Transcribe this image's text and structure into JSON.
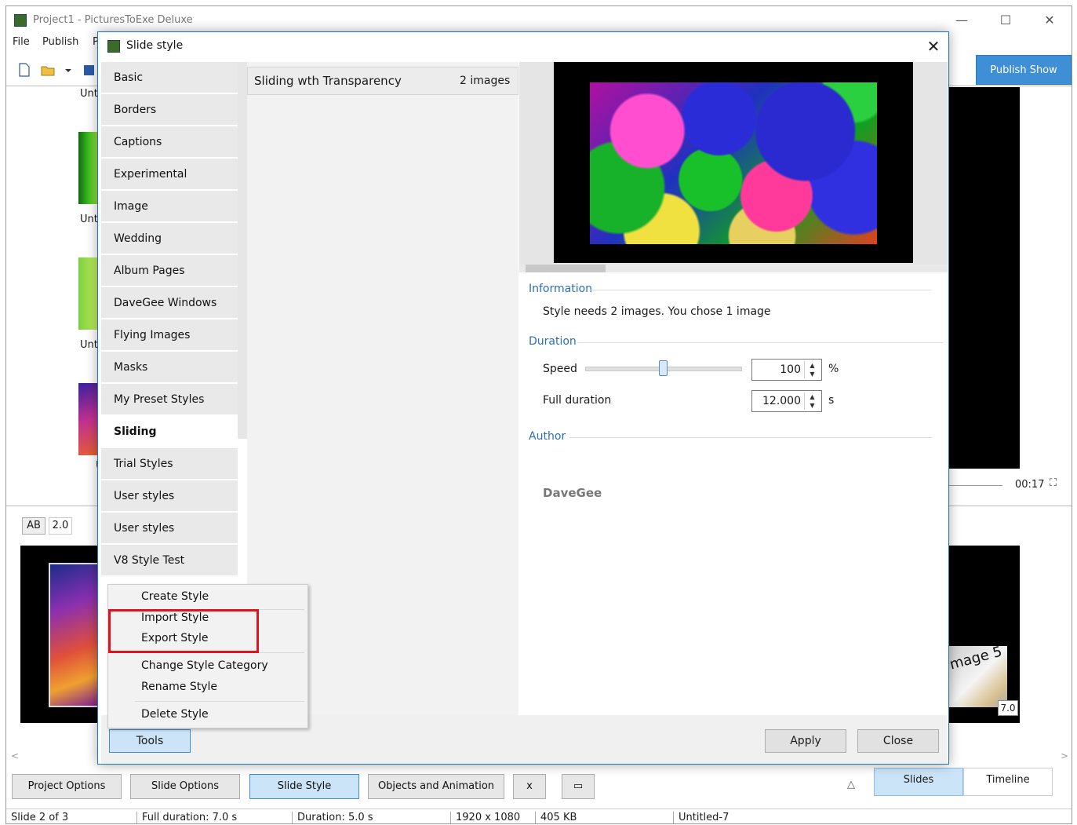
{
  "main_window": {
    "title": "Project1 - PicturesToExe Deluxe",
    "menu": [
      "File",
      "Publish",
      "P"
    ],
    "publish_button": "Publish Show",
    "minimize_glyph": "—",
    "maximize_glyph": "☐",
    "close_glyph": "✕"
  },
  "slide_list": {
    "labels": [
      "Unt",
      "Unt",
      "Unt",
      "U"
    ]
  },
  "preview": {
    "time": "00:17",
    "fullscreen_glyph": "⛶"
  },
  "timeline": {
    "ab_label": "AB",
    "ab_value": "2.0",
    "right_caption": "mage 5",
    "right_duration": "7.0"
  },
  "bottom_bar": {
    "buttons": [
      "Project Options",
      "Slide Options",
      "Slide Style",
      "Objects and Animation",
      "x",
      "▭"
    ],
    "triangle": "△",
    "tabs": [
      "Slides",
      "Timeline"
    ]
  },
  "statusbar": {
    "cells": [
      "Slide 2 of 3",
      "Full duration: 7.0 s",
      "Duration: 5.0 s",
      "1920 x 1080",
      "405 KB",
      "",
      "Untitled-7"
    ]
  },
  "dialog": {
    "title": "Slide style",
    "close_glyph": "✕",
    "categories": [
      "Basic",
      "Borders",
      "Captions",
      "Experimental",
      "Image",
      "Wedding",
      "Album Pages",
      "DaveGee Windows",
      "Flying Images",
      "Masks",
      "My Preset Styles",
      "Sliding",
      "Trial Styles",
      "User styles",
      "User styles",
      "V8 Style Test"
    ],
    "selected_category_index": 11,
    "style_item": {
      "name": "Sliding wth Transparency",
      "count": "2 images"
    },
    "information": {
      "heading": "Information",
      "text": "Style needs 2 images. You chose 1 image"
    },
    "duration": {
      "heading": "Duration",
      "speed_label": "Speed",
      "speed_value": "100",
      "speed_unit": "%",
      "full_duration_label": "Full duration",
      "full_duration_value": "12.000",
      "full_duration_unit": "s",
      "spin_glyph": "▲\n▼"
    },
    "author": {
      "heading": "Author",
      "name": "DaveGee"
    },
    "buttons": {
      "tools": "Tools",
      "apply": "Apply",
      "close": "Close"
    }
  },
  "tools_menu": {
    "items": [
      "Create Style",
      "Import Style",
      "Export Style",
      "Change Style Category",
      "Rename Style",
      "Delete Style"
    ]
  },
  "colors": {
    "accent": "#3c8fd6",
    "highlight_box": "#e0141e",
    "section_heading": "#2c6fb6"
  }
}
